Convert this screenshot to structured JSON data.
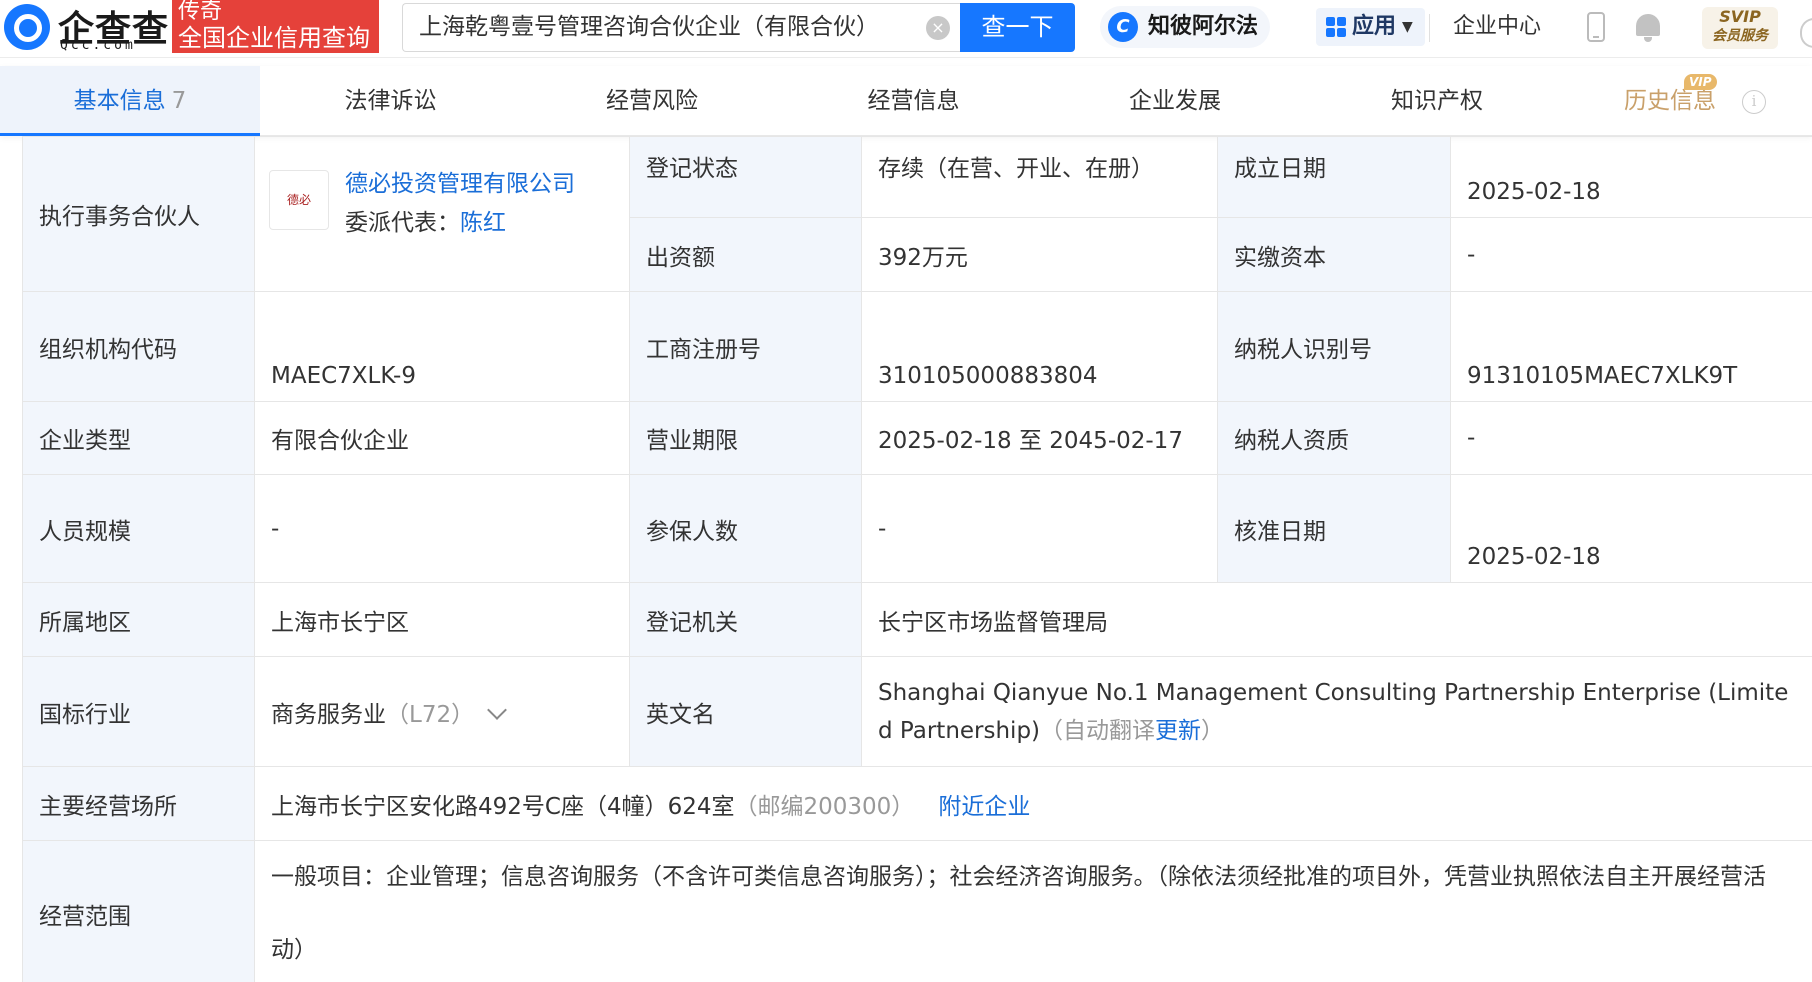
{
  "header": {
    "logo_text": "企查查",
    "logo_sub": "Qcc.com",
    "slogan_top": "传奇",
    "slogan_bottom": "全国企业信用查询",
    "search_value": "上海乾粤壹号管理咨询合伙企业（有限合伙）",
    "search_button": "查一下",
    "zhibi_label": "知彼阿尔法",
    "zhibi_icon_glyph": "C",
    "apps_label": "应用",
    "enterprise_center": "企业中心",
    "svip_top": "SVIP",
    "svip_bottom": "会员服务"
  },
  "tabs": [
    {
      "label": "基本信息",
      "count": "7"
    },
    {
      "label": "法律诉讼"
    },
    {
      "label": "经营风险"
    },
    {
      "label": "经营信息"
    },
    {
      "label": "企业发展"
    },
    {
      "label": "知识产权"
    },
    {
      "label": "历史信息",
      "badge": "VIP"
    }
  ],
  "info": {
    "executive_partner_label": "执行事务合伙人",
    "partner_logo_text": "德必",
    "partner_name": "德必投资管理有限公司",
    "partner_rep_label": "委派代表：",
    "partner_rep_name": "陈红",
    "reg_status_label": "登记状态",
    "reg_status_value": "存续（在营、开业、在册）",
    "founded_label": "成立日期",
    "founded_value": "2025-02-18",
    "capital_label": "出资额",
    "capital_value": "392万元",
    "paid_capital_label": "实缴资本",
    "paid_capital_value": "-",
    "org_code_label": "组织机构代码",
    "org_code_value": "MAEC7XLK-9",
    "biz_reg_no_label": "工商注册号",
    "biz_reg_no_value": "310105000883804",
    "taxpayer_id_label": "纳税人识别号",
    "taxpayer_id_value": "91310105MAEC7XLK9T",
    "ent_type_label": "企业类型",
    "ent_type_value": "有限合伙企业",
    "term_label": "营业期限",
    "term_value": "2025-02-18 至 2045-02-17",
    "tax_qual_label": "纳税人资质",
    "tax_qual_value": "-",
    "staff_label": "人员规模",
    "staff_value": "-",
    "insured_label": "参保人数",
    "insured_value": "-",
    "approval_label": "核准日期",
    "approval_value": "2025-02-18",
    "region_label": "所属地区",
    "region_value": "上海市长宁区",
    "reg_authority_label": "登记机关",
    "reg_authority_value": "长宁区市场监督管理局",
    "industry_label": "国标行业",
    "industry_value": "商务服务业",
    "industry_code": "（L72）",
    "english_name_label": "英文名",
    "english_name_value": "Shanghai Qianyue No.1 Management Consulting Partnership Enterprise (Limited Partnership)",
    "auto_translate": "（自动翻译",
    "update_link": "更新",
    "auto_translate_end": "）",
    "address_label": "主要经营场所",
    "address_value": "上海市长宁区安化路492号C座（4幢）624室",
    "postcode": "（邮编200300）",
    "nearby_link": "附近企业",
    "scope_label": "经营范围",
    "scope_value": "一般项目：企业管理；信息咨询服务（不含许可类信息咨询服务）；社会经济咨询服务。（除依法须经批准的项目外，凭营业执照依法自主开展经营活动）"
  },
  "colors": {
    "brand_blue": "#1677ff",
    "link_blue": "#1a6ed8",
    "slogan_red": "#e5413a",
    "label_bg": "#f2f6fc",
    "history_gold": "#c9a06a"
  }
}
